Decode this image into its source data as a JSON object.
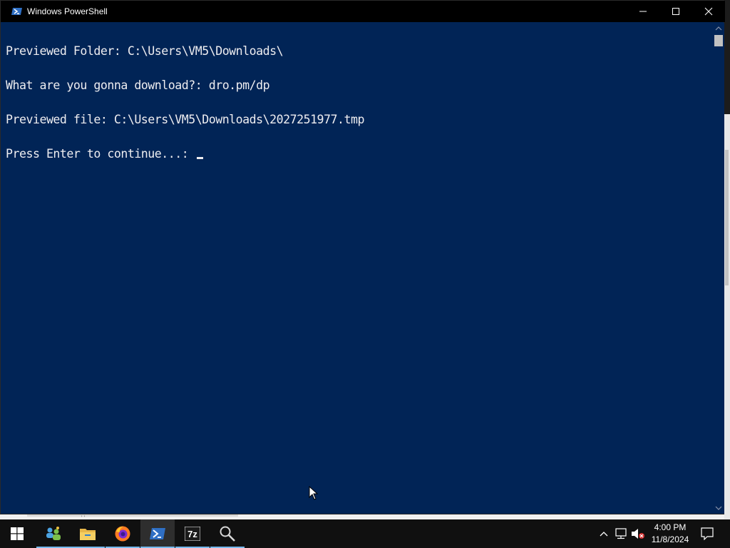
{
  "window": {
    "title": "Windows PowerShell"
  },
  "console": {
    "lines": [
      "Previewed Folder: C:\\Users\\VM5\\Downloads\\",
      "What are you gonna download?: dro.pm/dp",
      "Previewed file: C:\\Users\\VM5\\Downloads\\2027251977.tmp",
      "Press Enter to continue...: "
    ]
  },
  "taskbar": {
    "start_icon": "windows-logo-icon",
    "apps": [
      {
        "name": "network-people-icon",
        "label": ""
      },
      {
        "name": "file-explorer-icon",
        "label": ""
      },
      {
        "name": "firefox-icon",
        "label": ""
      },
      {
        "name": "powershell-icon",
        "label": ""
      },
      {
        "name": "7zip-icon",
        "label": "7z"
      },
      {
        "name": "search-magnifier-icon",
        "label": ""
      }
    ],
    "clock": {
      "time": "4:00 PM",
      "date": "11/8/2024"
    }
  },
  "colors": {
    "console_bg": "#012456",
    "console_fg": "#eeedf0",
    "titlebar_bg": "#000000",
    "taskbar_bg": "#101010",
    "accent": "#76b9ed"
  }
}
